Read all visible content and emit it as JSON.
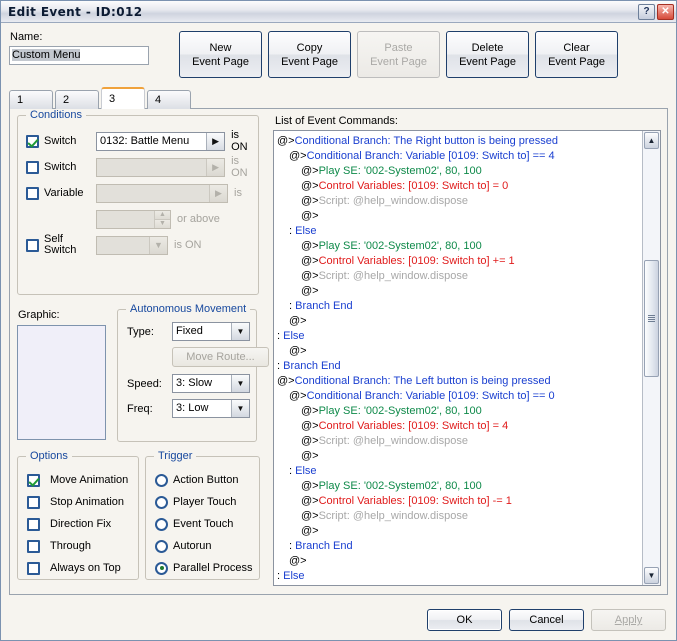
{
  "window": {
    "title": "Edit Event - ID:012",
    "help_button": "?",
    "close_button": "✕"
  },
  "name_field": {
    "label": "Name:",
    "value": "Custom Menu"
  },
  "page_buttons": [
    {
      "line1": "New",
      "line2": "Event Page",
      "disabled": false
    },
    {
      "line1": "Copy",
      "line2": "Event Page",
      "disabled": false
    },
    {
      "line1": "Paste",
      "line2": "Event Page",
      "disabled": true
    },
    {
      "line1": "Delete",
      "line2": "Event Page",
      "disabled": false
    },
    {
      "line1": "Clear",
      "line2": "Event Page",
      "disabled": false
    }
  ],
  "tabs": {
    "items": [
      "1",
      "2",
      "3",
      "4"
    ],
    "active_index": 2
  },
  "conditions": {
    "title": "Conditions",
    "rows": [
      {
        "label": "Switch",
        "checked": true,
        "value": "0132: Battle Menu",
        "suffix": "is ON",
        "arrow": "▶",
        "enabled": true
      },
      {
        "label": "Switch",
        "checked": false,
        "value": "",
        "suffix": "is ON",
        "arrow": "▶",
        "enabled": false
      },
      {
        "label": "Variable",
        "checked": false,
        "value": "",
        "suffix": "is",
        "arrow": "▶",
        "enabled": false
      },
      {
        "label": "Self Switch",
        "checked": false,
        "value": "",
        "suffix": "is ON",
        "arrow": "▼",
        "enabled": false
      }
    ],
    "spinner": {
      "value": "",
      "suffix": "or above",
      "up": "▲",
      "down": "▼"
    }
  },
  "graphic": {
    "label": "Graphic:",
    "preview_color": "#f0eff9"
  },
  "autonomous_movement": {
    "title": "Autonomous Movement",
    "type_label": "Type:",
    "type_value": "Fixed",
    "move_route_label": "Move Route...",
    "move_route_disabled": true,
    "speed_label": "Speed:",
    "speed_value": "3: Slow",
    "freq_label": "Freq:",
    "freq_value": "3: Low",
    "arrow": "▼"
  },
  "options": {
    "title": "Options",
    "items": [
      {
        "label": "Move Animation",
        "checked": true
      },
      {
        "label": "Stop Animation",
        "checked": false
      },
      {
        "label": "Direction Fix",
        "checked": false
      },
      {
        "label": "Through",
        "checked": false
      },
      {
        "label": "Always on Top",
        "checked": false
      }
    ]
  },
  "trigger": {
    "title": "Trigger",
    "items": [
      {
        "label": "Action Button",
        "selected": false
      },
      {
        "label": "Player Touch",
        "selected": false
      },
      {
        "label": "Event Touch",
        "selected": false
      },
      {
        "label": "Autorun",
        "selected": false
      },
      {
        "label": "Parallel Process",
        "selected": true
      }
    ]
  },
  "command_list": {
    "label": "List of Event Commands:",
    "colors": {
      "branch": "#1a3fd0",
      "sound": "#0f8a4a",
      "variable": "#e01b1b",
      "script": "#a8a8a8",
      "marker": "#000000"
    },
    "lines": [
      {
        "indent": 0,
        "marker": "@>",
        "text": "Conditional Branch: The Right button is being pressed",
        "color": "branch"
      },
      {
        "indent": 1,
        "marker": "@>",
        "text": "Conditional Branch: Variable [0109: Switch to] == 4",
        "color": "branch"
      },
      {
        "indent": 2,
        "marker": "@>",
        "text": "Play SE: '002-System02', 80, 100",
        "color": "sound"
      },
      {
        "indent": 2,
        "marker": "@>",
        "text": "Control Variables: [0109: Switch to] = 0",
        "color": "variable"
      },
      {
        "indent": 2,
        "marker": "@>",
        "text": "Script: @help_window.dispose",
        "color": "script"
      },
      {
        "indent": 2,
        "marker": "@>",
        "text": "",
        "color": "marker"
      },
      {
        "indent": 1,
        "marker": ":",
        "text": "Else",
        "color": "branch"
      },
      {
        "indent": 2,
        "marker": "@>",
        "text": "Play SE: '002-System02', 80, 100",
        "color": "sound"
      },
      {
        "indent": 2,
        "marker": "@>",
        "text": "Control Variables: [0109: Switch to] += 1",
        "color": "variable"
      },
      {
        "indent": 2,
        "marker": "@>",
        "text": "Script: @help_window.dispose",
        "color": "script"
      },
      {
        "indent": 2,
        "marker": "@>",
        "text": "",
        "color": "marker"
      },
      {
        "indent": 1,
        "marker": ":",
        "text": "Branch End",
        "color": "branch"
      },
      {
        "indent": 1,
        "marker": "@>",
        "text": "",
        "color": "marker"
      },
      {
        "indent": 0,
        "marker": ":",
        "text": "Else",
        "color": "branch"
      },
      {
        "indent": 1,
        "marker": "@>",
        "text": "",
        "color": "marker"
      },
      {
        "indent": 0,
        "marker": ":",
        "text": "Branch End",
        "color": "branch"
      },
      {
        "indent": 0,
        "marker": "@>",
        "text": "Conditional Branch: The Left button is being pressed",
        "color": "branch"
      },
      {
        "indent": 1,
        "marker": "@>",
        "text": "Conditional Branch: Variable [0109: Switch to] == 0",
        "color": "branch"
      },
      {
        "indent": 2,
        "marker": "@>",
        "text": "Play SE: '002-System02', 80, 100",
        "color": "sound"
      },
      {
        "indent": 2,
        "marker": "@>",
        "text": "Control Variables: [0109: Switch to] = 4",
        "color": "variable"
      },
      {
        "indent": 2,
        "marker": "@>",
        "text": "Script: @help_window.dispose",
        "color": "script"
      },
      {
        "indent": 2,
        "marker": "@>",
        "text": "",
        "color": "marker"
      },
      {
        "indent": 1,
        "marker": ":",
        "text": "Else",
        "color": "branch"
      },
      {
        "indent": 2,
        "marker": "@>",
        "text": "Play SE: '002-System02', 80, 100",
        "color": "sound"
      },
      {
        "indent": 2,
        "marker": "@>",
        "text": "Control Variables: [0109: Switch to] -= 1",
        "color": "variable"
      },
      {
        "indent": 2,
        "marker": "@>",
        "text": "Script: @help_window.dispose",
        "color": "script"
      },
      {
        "indent": 2,
        "marker": "@>",
        "text": "",
        "color": "marker"
      },
      {
        "indent": 1,
        "marker": ":",
        "text": "Branch End",
        "color": "branch"
      },
      {
        "indent": 1,
        "marker": "@>",
        "text": "",
        "color": "marker"
      },
      {
        "indent": 0,
        "marker": ":",
        "text": "Else",
        "color": "branch"
      }
    ],
    "scrollbar": {
      "up": "▲",
      "down": "▼"
    }
  },
  "footer": {
    "ok": "OK",
    "cancel": "Cancel",
    "apply": "Apply",
    "apply_disabled": true
  }
}
